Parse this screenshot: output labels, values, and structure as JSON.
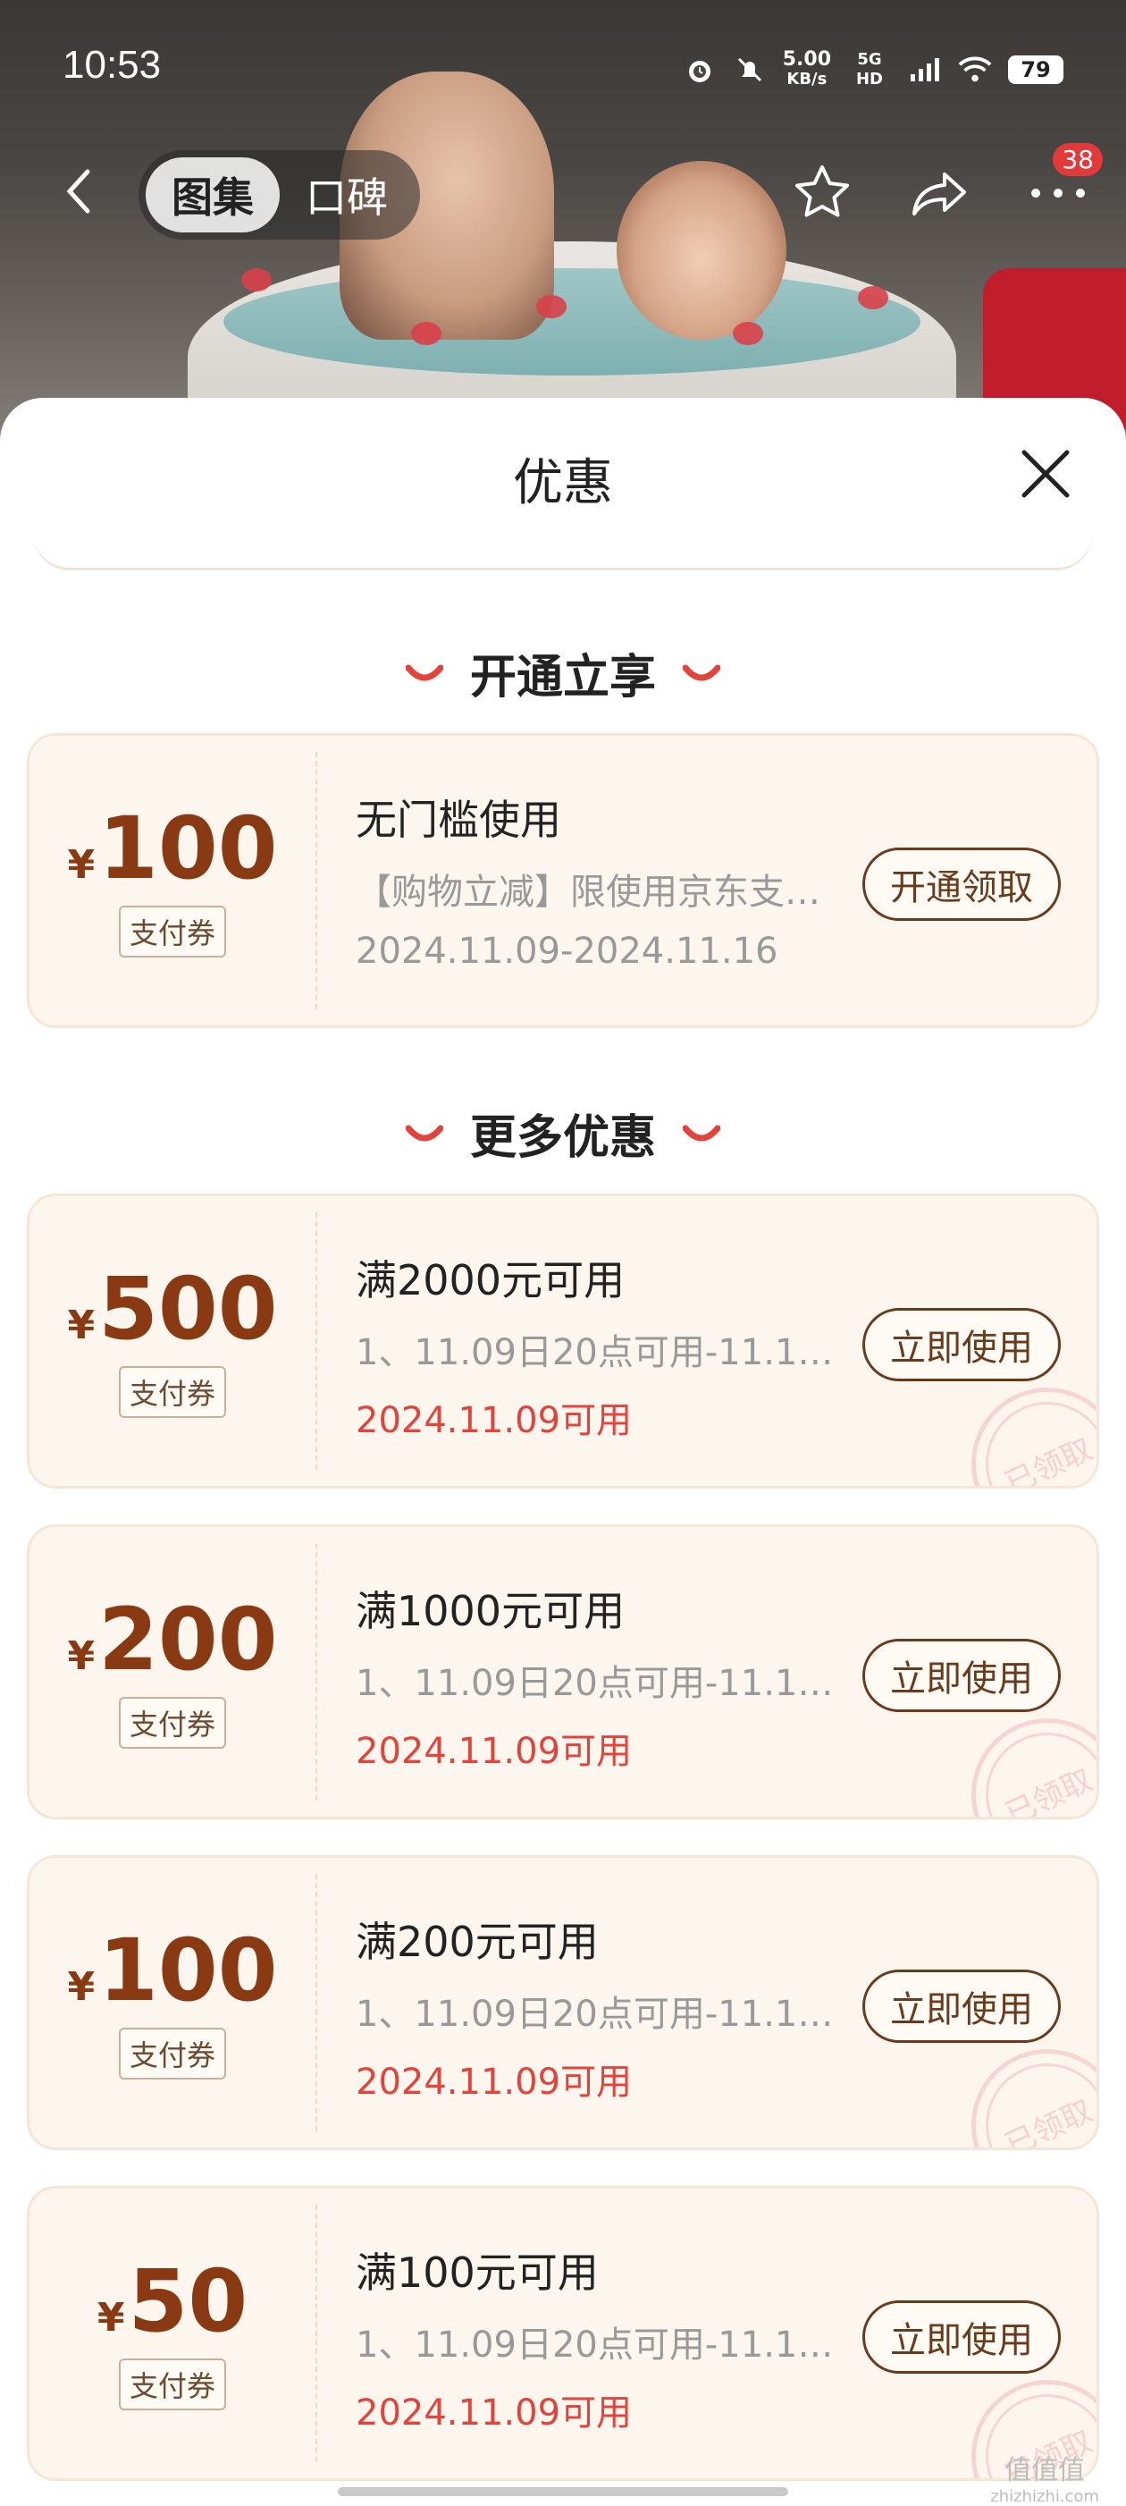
{
  "status_bar": {
    "time": "10:53",
    "net_speed_value": "5.00",
    "net_speed_unit": "KB/s",
    "network": "5G HD",
    "battery": "79"
  },
  "nav": {
    "tab_gallery": "图集",
    "tab_reviews": "口碑",
    "badge_count": "38"
  },
  "sheet": {
    "title": "优惠"
  },
  "section_open": {
    "title": "开通立享"
  },
  "section_more": {
    "title": "更多优惠"
  },
  "coupons_open": [
    {
      "currency": "¥",
      "amount": "100",
      "type": "支付券",
      "title": "无门槛使用",
      "desc": "【购物立减】限使用京东支付…",
      "date": "2024.11.09-2024.11.16",
      "date_highlight": false,
      "button": "开通领取",
      "claimed": false
    }
  ],
  "coupons_more": [
    {
      "currency": "¥",
      "amount": "500",
      "type": "支付券",
      "title": "满2000元可用",
      "desc": "1、11.09日20点可用-11.11…",
      "date": "2024.11.09可用",
      "date_highlight": true,
      "button": "立即使用",
      "claimed": true,
      "stamp_text": "已领取"
    },
    {
      "currency": "¥",
      "amount": "200",
      "type": "支付券",
      "title": "满1000元可用",
      "desc": "1、11.09日20点可用-11.11…",
      "date": "2024.11.09可用",
      "date_highlight": true,
      "button": "立即使用",
      "claimed": true,
      "stamp_text": "已领取"
    },
    {
      "currency": "¥",
      "amount": "100",
      "type": "支付券",
      "title": "满200元可用",
      "desc": "1、11.09日20点可用-11.11…",
      "date": "2024.11.09可用",
      "date_highlight": true,
      "button": "立即使用",
      "claimed": true,
      "stamp_text": "已领取"
    },
    {
      "currency": "¥",
      "amount": "50",
      "type": "支付券",
      "title": "满100元可用",
      "desc": "1、11.09日20点可用-11.11…",
      "date": "2024.11.09可用",
      "date_highlight": true,
      "button": "立即使用",
      "claimed": true,
      "stamp_text": "已领取"
    }
  ],
  "watermark": {
    "text": "值值值",
    "site": "zhizhizhi.com"
  },
  "colors": {
    "accent_red": "#e2433a",
    "amount_brown": "#8a3a12",
    "coupon_bg": "#fdf6ef",
    "button_border": "#6a3a1c"
  }
}
